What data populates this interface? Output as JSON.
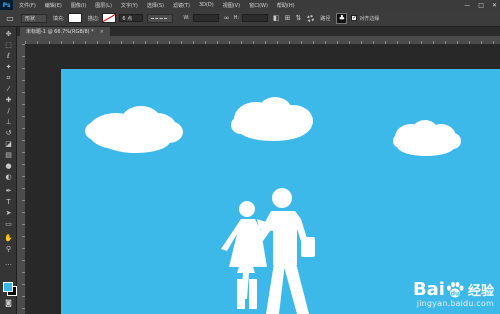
{
  "app": {
    "logo": "Ps"
  },
  "menubar": {
    "items": [
      "文件(F)",
      "编辑(E)",
      "图像(I)",
      "图层(L)",
      "文字(Y)",
      "选择(S)",
      "滤镜(T)",
      "3D(D)",
      "视图(V)",
      "窗口(W)",
      "帮助(H)"
    ],
    "window_controls": [
      "—",
      "□",
      "✕"
    ]
  },
  "options": {
    "mode_label": "形状",
    "fill_label": "填充:",
    "stroke_label": "描边:",
    "stroke_size": "6 点",
    "w_label": "W:",
    "h_label": "H:",
    "align_edges_label": "对齐边缘",
    "icon_paths": "路径"
  },
  "document": {
    "tab_title": "未标题-1 @ 66.7%(RGB/8) *",
    "tab_close": "×",
    "canvas_color": "#3cb8e9"
  },
  "watermark": {
    "brand_left": "Bai",
    "brand_right": "du",
    "brand_cn": "经验",
    "url": "jingyan.baidu.com"
  },
  "colors": {
    "foreground": "#3ab7e8",
    "background": "#000000"
  }
}
